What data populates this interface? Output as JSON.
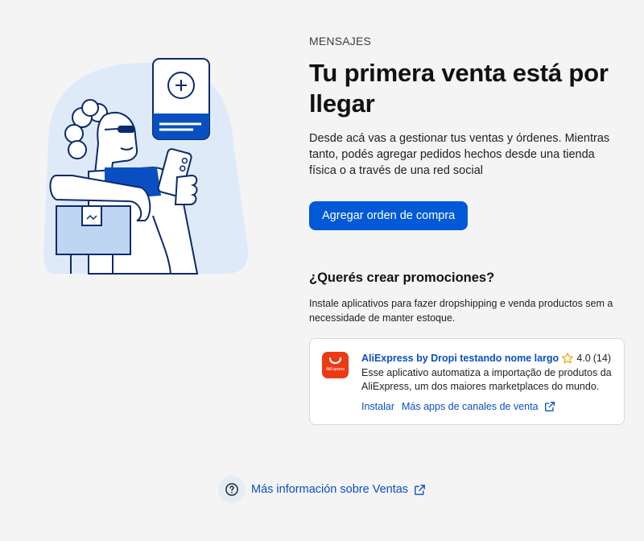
{
  "header": {
    "eyebrow": "MENSAJES",
    "title": "Tu primera venta está por llegar",
    "description": "Desde acá vas a gestionar tus ventas y órdenes. Mientras tanto, podés agregar pedidos hechos desde una tienda física o a través de una red social"
  },
  "actions": {
    "add_order_label": "Agregar orden de compra"
  },
  "promotions": {
    "title": "¿Querés crear promociones?",
    "description": "Instale aplicativos para fazer dropshipping e venda productos sem a necessidade de manter estoque.",
    "app": {
      "name": "AliExpress by Dropi testando nome largo",
      "logo_text": "AliExpress",
      "rating": "4.0",
      "reviews": "(14)",
      "description": "Esse aplicativo automatiza a importação de produtos da AliExpress, um dos maiores marketplaces do mundo.",
      "install_label": "Instalar",
      "more_apps_label": "Más apps de canales de venta",
      "brand_color": "#ec3a15"
    }
  },
  "footer": {
    "info_link_label": "Más información sobre Ventas"
  },
  "icons": {
    "help": "help-circle-icon",
    "external": "external-link-icon",
    "star": "star-outline-icon"
  },
  "colors": {
    "accent": "#0059d6",
    "link": "#0a4fc2",
    "illustration_bg": "#dfeaf9"
  }
}
